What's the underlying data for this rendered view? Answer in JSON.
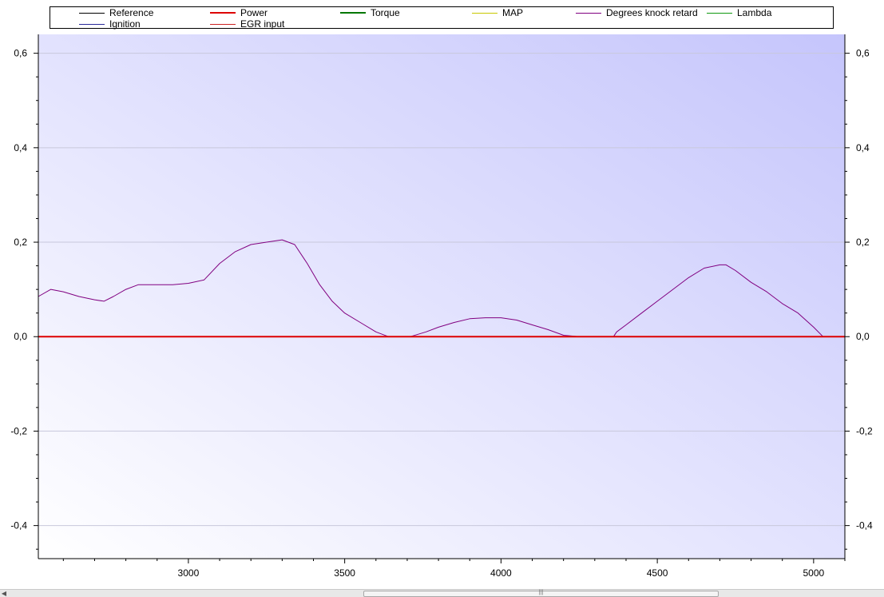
{
  "legend": [
    {
      "label": "Reference",
      "color": "#000000"
    },
    {
      "label": "Ignition",
      "color": "#2a2a9a"
    },
    {
      "label": "Power",
      "color": "#dd0000"
    },
    {
      "label": "EGR input",
      "color": "#cc2222"
    },
    {
      "label": "Torque",
      "color": "#007700"
    },
    {
      "label": "MAP",
      "color": "#c8c800"
    },
    {
      "label": "Degrees knock retard",
      "color": "#800080"
    },
    {
      "label": "Lambda",
      "color": "#119911"
    }
  ],
  "chart_data": {
    "type": "line",
    "xlim": [
      2520,
      5100
    ],
    "ylim": [
      -0.47,
      0.64
    ],
    "x_ticks": [
      3000,
      3500,
      4000,
      4500,
      5000
    ],
    "y_ticks": [
      -0.4,
      -0.2,
      0.0,
      0.2,
      0.4,
      0.6
    ],
    "y_tick_labels": [
      "-0,4",
      "-0,2",
      "0,0",
      "0,2",
      "0,4",
      "0,6"
    ],
    "grid": true,
    "dual_y_axis": true,
    "legend_position": "top",
    "background_gradient": [
      "#ffffff",
      "#c5c5fc"
    ],
    "series": [
      {
        "name": "Degrees knock retard",
        "color": "#800080",
        "x": [
          2520,
          2560,
          2600,
          2650,
          2700,
          2730,
          2760,
          2800,
          2840,
          2900,
          2950,
          3000,
          3050,
          3100,
          3150,
          3200,
          3250,
          3300,
          3340,
          3380,
          3420,
          3460,
          3500,
          3550,
          3600,
          3640,
          3650,
          3700,
          3710,
          3760,
          3800,
          3850,
          3900,
          3950,
          4000,
          4050,
          4100,
          4150,
          4200,
          4250,
          4300,
          4360,
          4370,
          4400,
          4450,
          4500,
          4550,
          4600,
          4650,
          4700,
          4720,
          4750,
          4800,
          4850,
          4900,
          4950,
          5000,
          5030,
          5100
        ],
        "y": [
          0.085,
          0.1,
          0.095,
          0.085,
          0.078,
          0.075,
          0.085,
          0.1,
          0.11,
          0.11,
          0.11,
          0.113,
          0.12,
          0.155,
          0.18,
          0.195,
          0.2,
          0.205,
          0.195,
          0.155,
          0.11,
          0.075,
          0.05,
          0.03,
          0.01,
          0.0,
          0.0,
          0.0,
          0.0,
          0.01,
          0.02,
          0.03,
          0.038,
          0.04,
          0.04,
          0.035,
          0.025,
          0.015,
          0.003,
          0.0,
          0.0,
          0.0,
          0.01,
          0.025,
          0.05,
          0.075,
          0.1,
          0.125,
          0.145,
          0.152,
          0.152,
          0.14,
          0.115,
          0.095,
          0.07,
          0.05,
          0.02,
          0.0,
          0.0
        ]
      },
      {
        "name": "Power",
        "color": "#dd0000",
        "x": [
          2520,
          5100
        ],
        "y": [
          0.0,
          0.0
        ]
      }
    ]
  }
}
